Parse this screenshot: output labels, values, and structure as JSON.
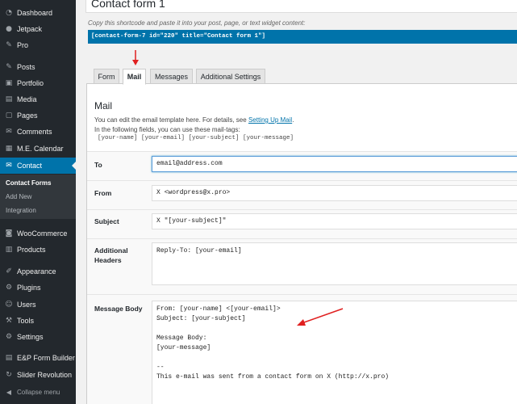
{
  "sidebar": {
    "items": [
      {
        "label": "Dashboard",
        "icon": "dashboard-icon",
        "glyph": "◔"
      },
      {
        "label": "Jetpack",
        "icon": "jetpack-icon",
        "glyph": "●"
      },
      {
        "label": "Pro",
        "icon": "pro-icon",
        "glyph": "✎"
      },
      {
        "label": "Posts",
        "icon": "posts-icon",
        "glyph": "✎"
      },
      {
        "label": "Portfolio",
        "icon": "portfolio-icon",
        "glyph": "▣"
      },
      {
        "label": "Media",
        "icon": "media-icon",
        "glyph": "▤"
      },
      {
        "label": "Pages",
        "icon": "pages-icon",
        "glyph": "▢"
      },
      {
        "label": "Comments",
        "icon": "comments-icon",
        "glyph": "✉"
      },
      {
        "label": "M.E. Calendar",
        "icon": "calendar-icon",
        "glyph": "▦"
      },
      {
        "label": "Contact",
        "icon": "contact-icon",
        "glyph": "✉"
      },
      {
        "label": "WooCommerce",
        "icon": "woocommerce-icon",
        "glyph": "◙"
      },
      {
        "label": "Products",
        "icon": "products-icon",
        "glyph": "▥"
      },
      {
        "label": "Appearance",
        "icon": "appearance-icon",
        "glyph": "✐"
      },
      {
        "label": "Plugins",
        "icon": "plugins-icon",
        "glyph": "⚙"
      },
      {
        "label": "Users",
        "icon": "users-icon",
        "glyph": "☺"
      },
      {
        "label": "Tools",
        "icon": "tools-icon",
        "glyph": "⚒"
      },
      {
        "label": "Settings",
        "icon": "settings-icon",
        "glyph": "⚙"
      },
      {
        "label": "E&P Form Builder",
        "icon": "form-builder-icon",
        "glyph": "▤"
      },
      {
        "label": "Slider Revolution",
        "icon": "slider-revolution-icon",
        "glyph": "↻"
      }
    ],
    "submenu": [
      "Contact Forms",
      "Add New",
      "Integration"
    ],
    "collapse_label": "Collapse menu",
    "collapse_icon": "collapse-icon",
    "colors": {
      "bg": "#23282d",
      "active": "#0073aa"
    }
  },
  "form": {
    "title": "Contact form 1",
    "shortcode_hint": "Copy this shortcode and paste it into your post, page, or text widget content:",
    "shortcode": "[contact-form-7 id=\"220\" title=\"Contact form 1\"]"
  },
  "tabs": [
    {
      "label": "Form"
    },
    {
      "label": "Mail",
      "active": true
    },
    {
      "label": "Messages"
    },
    {
      "label": "Additional Settings"
    }
  ],
  "mail": {
    "heading": "Mail",
    "desc_prefix": "You can edit the email template here. For details, see ",
    "desc_link": "Setting Up Mail",
    "desc_suffix": ".",
    "desc_line2": "In the following fields, you can use these mail-tags:",
    "mailtags": "[your-name] [your-email] [your-subject] [your-message]",
    "fields": {
      "to": {
        "label": "To",
        "value": "email@address.com"
      },
      "from": {
        "label": "From",
        "value": "X <wordpress@x.pro>"
      },
      "subject": {
        "label": "Subject",
        "value": "X \"[your-subject]\""
      },
      "headers": {
        "label": "Additional Headers",
        "value": "Reply-To: [your-email]"
      },
      "body": {
        "label": "Message Body",
        "value": "From: [your-name] <[your-email]>\nSubject: [your-subject]\n\nMessage Body:\n[your-message]\n\n--\nThis e-mail was sent from a contact form on X (http://x.pro)"
      }
    }
  },
  "annotation_color": "#e02020"
}
